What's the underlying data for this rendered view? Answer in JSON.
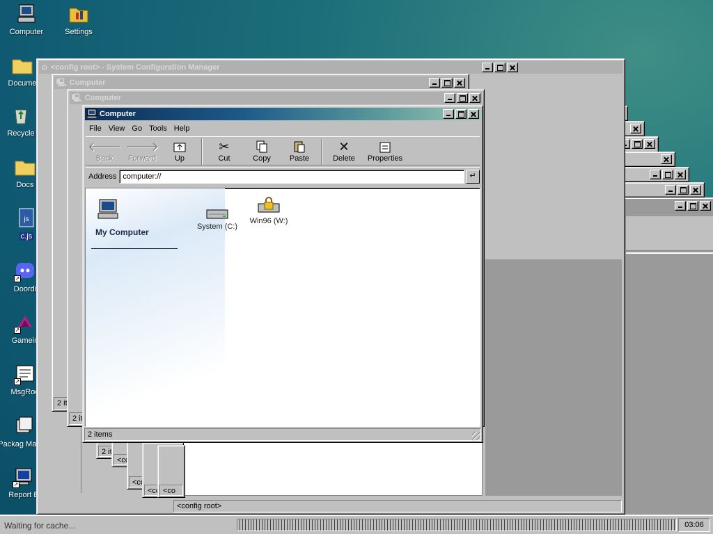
{
  "desktop_icons": [
    {
      "label": "Computer",
      "icon": "computer-icon"
    },
    {
      "label": "Settings",
      "icon": "settings-folder-icon"
    },
    {
      "label": "Docume",
      "icon": "folder-icon"
    },
    {
      "label": "Recycle",
      "icon": "recycle-bin-icon"
    },
    {
      "label": "Docs",
      "icon": "folder-icon"
    },
    {
      "label": "c.js",
      "icon": "js-file-icon"
    },
    {
      "label": "Doordi",
      "icon": "discord-icon"
    },
    {
      "label": "Gamein",
      "icon": "game-icon"
    },
    {
      "label": "MsgRoo",
      "icon": "message-icon"
    },
    {
      "label": "Packag Manag",
      "icon": "package-icon"
    },
    {
      "label": "Report B",
      "icon": "report-icon"
    }
  ],
  "windows": {
    "config_manager": {
      "title": "<config root> - System Configuration Manager",
      "status": "<config root>"
    },
    "computer_back1": {
      "title": "Computer"
    },
    "computer_back2": {
      "title": "Computer"
    },
    "computer_main": {
      "title": "Computer",
      "menu": [
        "File",
        "View",
        "Go",
        "Tools",
        "Help"
      ],
      "toolbar": [
        {
          "label": "Back",
          "icon": "back-arrow-icon",
          "disabled": true
        },
        {
          "label": "Forward",
          "icon": "forward-arrow-icon",
          "disabled": true
        },
        {
          "label": "Up",
          "icon": "up-folder-icon",
          "disabled": false
        },
        {
          "label": "Cut",
          "icon": "scissors-icon",
          "disabled": false
        },
        {
          "label": "Copy",
          "icon": "copy-icon",
          "disabled": false
        },
        {
          "label": "Paste",
          "icon": "paste-icon",
          "disabled": false
        },
        {
          "label": "Delete",
          "icon": "delete-x-icon",
          "disabled": false
        },
        {
          "label": "Properties",
          "icon": "properties-icon",
          "disabled": false
        }
      ],
      "address_label": "Address",
      "address_value": "computer://",
      "sidebar_title": "My Computer",
      "items": [
        {
          "label": "System (C:)",
          "icon": "hard-drive-icon"
        },
        {
          "label": "Win96 (W:)",
          "icon": "locked-drive-icon"
        }
      ],
      "status": "2 items"
    },
    "back_status_texts": [
      "2 ite",
      "2 ite",
      "2 it",
      "<co",
      "<co",
      "<co",
      "<co",
      "<co"
    ]
  },
  "taskbar": {
    "status_text": "Waiting for cache...",
    "clock": "03:06"
  }
}
